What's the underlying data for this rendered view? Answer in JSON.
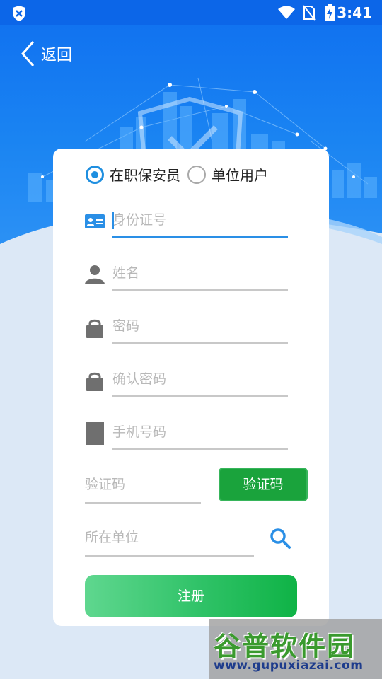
{
  "status_bar": {
    "time": "3:41"
  },
  "header": {
    "back_label": "返回"
  },
  "user_type": {
    "options": [
      "在职保安员",
      "单位用户"
    ],
    "selected": "在职保安员"
  },
  "form": {
    "id_number": {
      "placeholder": "身份证号",
      "value": ""
    },
    "name": {
      "placeholder": "姓名",
      "value": ""
    },
    "password": {
      "placeholder": "密码",
      "value": ""
    },
    "confirm_password": {
      "placeholder": "确认密码",
      "value": ""
    },
    "phone": {
      "placeholder": "手机号码",
      "value": ""
    },
    "verification_code": {
      "placeholder": "验证码",
      "value": ""
    },
    "get_code_label": "验证码",
    "company": {
      "placeholder": "所在单位",
      "value": ""
    },
    "register_label": "注册"
  },
  "watermark": {
    "title": "谷普软件园",
    "url": "www.gupuxiazai.com"
  },
  "colors": {
    "primary_blue": "#1a84f2",
    "accent_blue": "#2a8fe6",
    "button_green": "#1aa33c"
  }
}
